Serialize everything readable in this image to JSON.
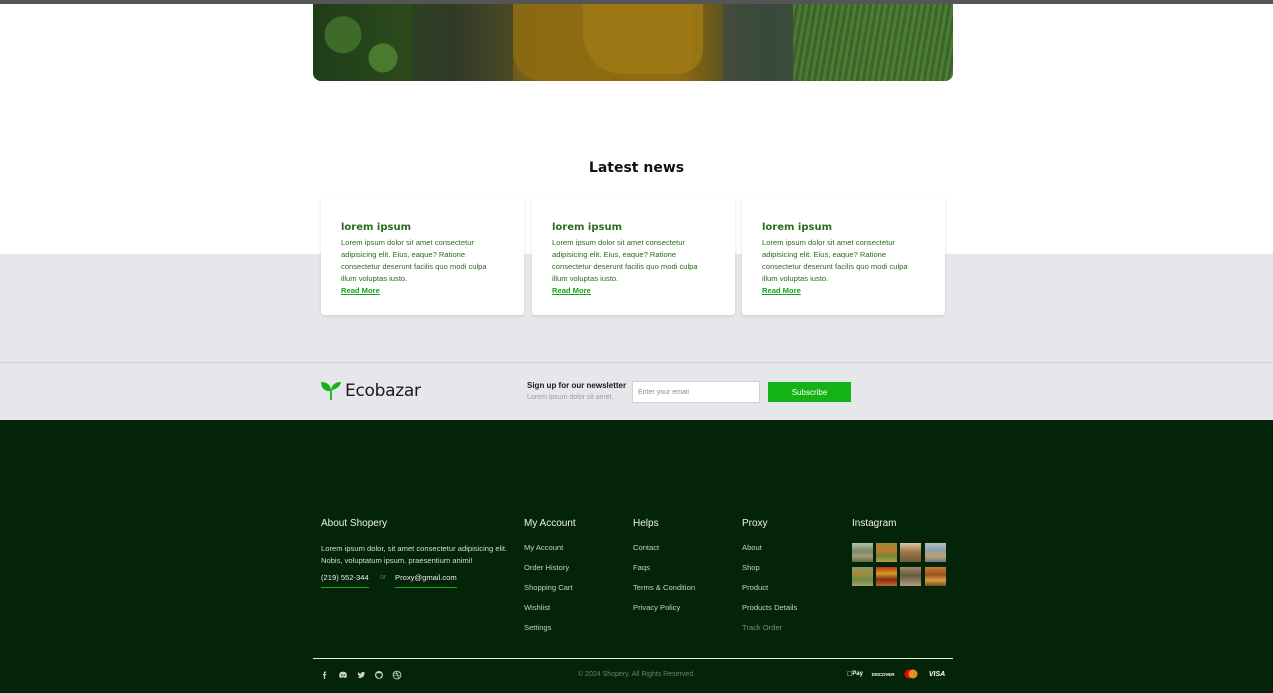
{
  "news": {
    "title": "Latest news",
    "cards": [
      {
        "title": "lorem ipsum",
        "text": "Lorem ipsum dolor sit amet consectetur adipisicing elit. Eius, eaque? Ratione consectetur deserunt facilis quo modi culpa illum voluptas iusto.",
        "link": "Read More"
      },
      {
        "title": "lorem ipsum",
        "text": "Lorem ipsum dolor sit amet consectetur adipisicing elit. Eius, eaque? Ratione consectetur deserunt facilis quo modi culpa illum voluptas iusto.",
        "link": "Read More"
      },
      {
        "title": "lorem ipsum",
        "text": "Lorem ipsum dolor sit amet consectetur adipisicing elit. Eius, eaque? Ratione consectetur deserunt facilis quo modi culpa illum voluptas iusto.",
        "link": "Read More"
      }
    ]
  },
  "brand": {
    "name": "Ecobazar",
    "icon": "leaf-icon",
    "accent": "#14b314"
  },
  "newsletter": {
    "title": "Sign up for our newsletter",
    "subtitle": "Lorem ipsum dolor sit amet.",
    "placeholder": "Enter your email",
    "button": "Subscribe"
  },
  "footer": {
    "background": "#04240a",
    "about": {
      "title": "About Shopery",
      "text": "Lorem ipsum dolor, sit amet consectetur adipisicing elit. Nobis, voluptatum ipsum. praesentium animi!",
      "phone": "(219) 552-344",
      "or": "or",
      "email": "Proxy@gmail.com"
    },
    "my_account": {
      "title": "My Account",
      "links": [
        "My Account",
        "Order History",
        "Shopping Cart",
        "Wishlist",
        "Settings"
      ]
    },
    "helps": {
      "title": "Helps",
      "links": [
        "Contact",
        "Faqs",
        "Terms & Condition",
        "Privacy Policy"
      ]
    },
    "proxy": {
      "title": "Proxy",
      "links": [
        "About",
        "Shop",
        "Product",
        "Products Details",
        "Track Order"
      ]
    },
    "instagram": {
      "title": "Instagram"
    },
    "social_icons": [
      "facebook-icon",
      "discord-icon",
      "twitter-icon",
      "github-icon",
      "dribbble-icon"
    ],
    "copyright": "© 2024 Shopery. All Rights Reserved.",
    "payments": {
      "apple_pay": "Pay",
      "discover": "DISCOVER",
      "mastercard": "mastercard-icon",
      "visa": "VISA"
    }
  }
}
